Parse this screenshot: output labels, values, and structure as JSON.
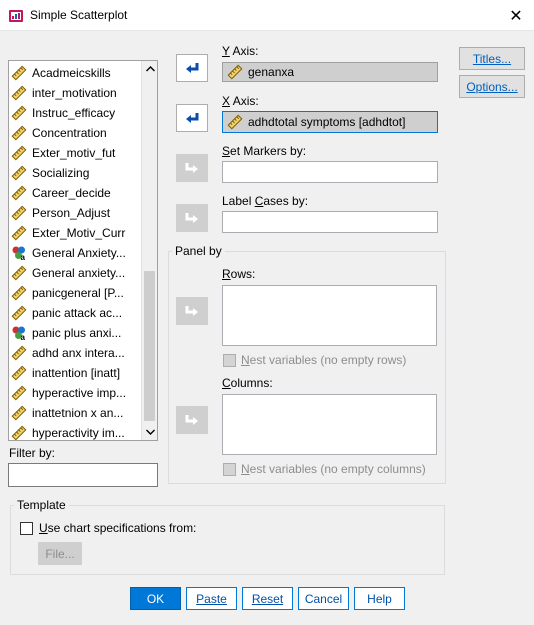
{
  "window": {
    "title": "Simple Scatterplot",
    "close_glyph": "✕"
  },
  "variables": [
    {
      "label": "Acadmeicskills",
      "icon": "ruler-icon"
    },
    {
      "label": "inter_motivation",
      "icon": "ruler-icon"
    },
    {
      "label": "Instruc_efficacy",
      "icon": "ruler-icon"
    },
    {
      "label": "Concentration",
      "icon": "ruler-icon"
    },
    {
      "label": "Exter_motiv_fut",
      "icon": "ruler-icon"
    },
    {
      "label": "Socializing",
      "icon": "ruler-icon"
    },
    {
      "label": "Career_decide",
      "icon": "ruler-icon"
    },
    {
      "label": "Person_Adjust",
      "icon": "ruler-icon"
    },
    {
      "label": "Exter_Motiv_Curr",
      "icon": "ruler-icon"
    },
    {
      "label": "General Anxiety...",
      "icon": "nominal-icon"
    },
    {
      "label": "General anxiety...",
      "icon": "ruler-icon"
    },
    {
      "label": "panicgeneral [P...",
      "icon": "ruler-icon"
    },
    {
      "label": "panic attack ac...",
      "icon": "ruler-icon"
    },
    {
      "label": "panic plus anxi...",
      "icon": "nominal-icon"
    },
    {
      "label": "adhd anx intera...",
      "icon": "ruler-icon"
    },
    {
      "label": "inattention [inatt]",
      "icon": "ruler-icon"
    },
    {
      "label": "hyperactive imp...",
      "icon": "ruler-icon"
    },
    {
      "label": "inattetnion x an...",
      "icon": "ruler-icon"
    },
    {
      "label": "hyperactivity im...",
      "icon": "ruler-icon"
    }
  ],
  "filter": {
    "label": "Filter by:",
    "value": ""
  },
  "y_axis": {
    "label": "Y Axis:",
    "value": "genanxa"
  },
  "x_axis": {
    "label": "X Axis:",
    "value": "adhdtotal symptoms [adhdtot]"
  },
  "set_markers": {
    "label": "Set Markers by:",
    "value": ""
  },
  "label_cases": {
    "label": "Label Cases by:",
    "value": ""
  },
  "panel": {
    "title": "Panel by",
    "rows_label": "Rows:",
    "nest_rows": "Nest variables (no empty rows)",
    "columns_label": "Columns:",
    "nest_columns": "Nest variables (no empty columns)"
  },
  "side_buttons": {
    "titles": "Titles...",
    "options": "Options..."
  },
  "template": {
    "title": "Template",
    "use_chart": "Use chart specifications from:",
    "file": "File..."
  },
  "buttons": {
    "ok": "OK",
    "paste": "Paste",
    "reset": "Reset",
    "cancel": "Cancel",
    "help": "Help"
  },
  "colors": {
    "accent": "#0078d7",
    "disabled": "#cfcfcf"
  }
}
